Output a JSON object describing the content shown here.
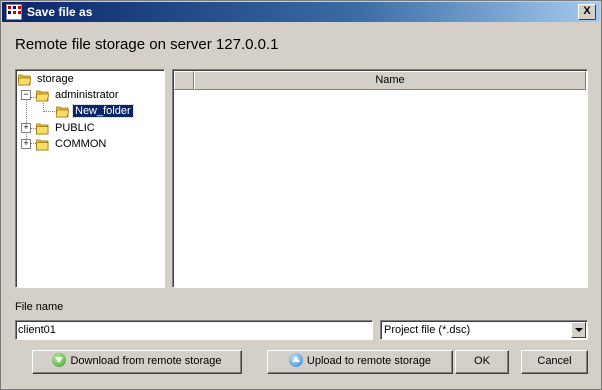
{
  "window": {
    "title": "Save file as",
    "close_glyph": "X"
  },
  "heading": "Remote file storage on server 127.0.0.1",
  "tree": {
    "nodes": [
      {
        "label": "storage",
        "icon": "folder-open-icon"
      },
      {
        "label": "administrator",
        "icon": "folder-open-icon",
        "expander": "−"
      },
      {
        "label": "New_folder",
        "icon": "folder-open-icon",
        "selected": true
      },
      {
        "label": "PUBLIC",
        "icon": "folder-icon",
        "expander": "+"
      },
      {
        "label": "COMMON",
        "icon": "folder-icon",
        "expander": "+"
      }
    ]
  },
  "list": {
    "columns": [
      "",
      "Name"
    ],
    "rows": []
  },
  "file_name": {
    "label": "File name",
    "value": "client01"
  },
  "file_type": {
    "selected": "Project file (*.dsc)"
  },
  "buttons": {
    "download": "Download from remote storage",
    "upload": "Upload to remote storage",
    "ok": "OK",
    "cancel": "Cancel"
  },
  "colors": {
    "face": "#d4d0c8",
    "titlebar": "#0a246a",
    "selection": "#0a246a",
    "folder": "#f5d25a"
  }
}
